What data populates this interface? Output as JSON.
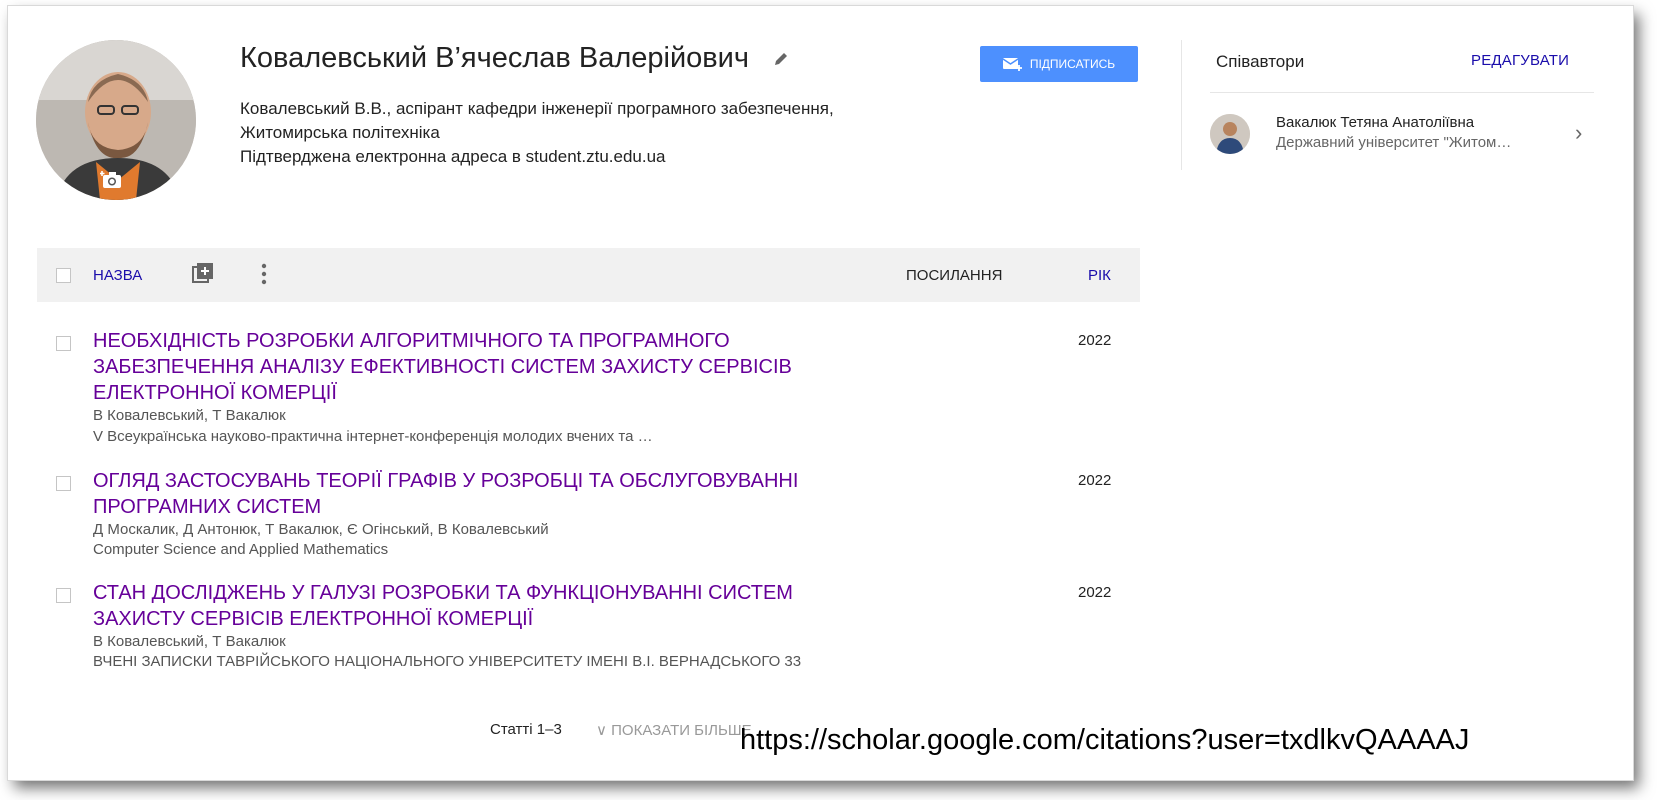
{
  "profile": {
    "name": "Ковалевський В’ячеслав Валерійович",
    "affiliation_line1": "Ковалевський В.В., аспірант кафедри інженерії програмного забезпечення,",
    "affiliation_line2": "Житомирська політехніка",
    "email_verified": "Підтверджена електронна адреса в student.ztu.edu.ua",
    "follow_label": "ПІДПИСАТИСЬ"
  },
  "coauthors": {
    "title": "Співавтори",
    "edit_label": "РЕДАГУВАТИ",
    "items": [
      {
        "name": "Вакалюк Тетяна Анатоліївна",
        "affiliation": "Державний університет \"Житом…"
      }
    ]
  },
  "table": {
    "col_title": "НАЗВА",
    "col_citations": "ПОСИЛАННЯ",
    "col_year": "РІК"
  },
  "articles": [
    {
      "title": "НЕОБХІДНІСТЬ РОЗРОБКИ АЛГОРИТМІЧНОГО ТА ПРОГРАМНОГО ЗАБЕЗПЕЧЕННЯ АНАЛІЗУ ЕФЕКТИВНОСТІ СИСТЕМ ЗАХИСТУ СЕРВІСІВ ЕЛЕКТРОННОЇ КОМЕРЦІЇ",
      "authors": "В Ковалевський, Т Вакалюк",
      "venue": "V Всеукраїнська науково-практична інтернет-конференція молодих вчених та …",
      "year": "2022"
    },
    {
      "title": "ОГЛЯД ЗАСТОСУВАНЬ ТЕОРІЇ ГРАФІВ У РОЗРОБЦІ ТА ОБСЛУГОВУВАННІ ПРОГРАМНИХ СИСТЕМ",
      "authors": "Д Москалик, Д Антонюк, Т Вакалюк, Є Огінський, В Ковалевський",
      "venue": "Computer Science and Applied Mathematics",
      "year": "2022"
    },
    {
      "title": "СТАН ДОСЛІДЖЕНЬ У ГАЛУЗІ РОЗРОБКИ ТА ФУНКЦІОНУВАННІ СИСТЕМ ЗАХИСТУ СЕРВІСІВ ЕЛЕКТРОННОЇ КОМЕРЦІЇ",
      "authors": "В Ковалевський, Т Вакалюк",
      "venue": "ВЧЕНІ ЗАПИСКИ ТАВРІЙСЬКОГО НАЦІОНАЛЬНОГО УНІВЕРСИТЕТУ ІМЕНІ В.І. ВЕРНАДСЬКОГО 33",
      "year": "2022"
    }
  ],
  "footer": {
    "count_label": "Статті 1–3",
    "show_more_label": "∨ ПОКАЗАТИ БІЛЬШЕ"
  },
  "caption_url": "https://scholar.google.com/citations?user=txdlkvQAAAAJ",
  "colors": {
    "link": "#1a0dab",
    "visited_title": "#660099",
    "follow_button": "#4d90fe",
    "header_bg": "#f1f1f1"
  }
}
